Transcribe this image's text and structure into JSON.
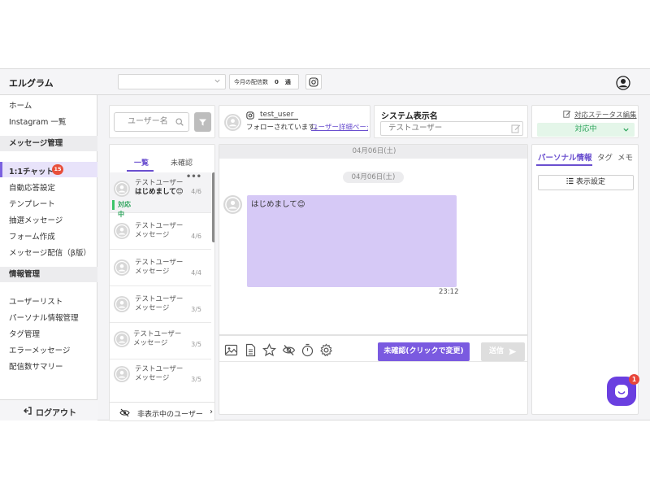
{
  "header": {
    "logo": "エルグラム",
    "account_select_value": "",
    "delivery_label": "今月の配信数",
    "delivery_count": "0",
    "delivery_unit": "通"
  },
  "sidebar": {
    "home": "ホーム",
    "instagram_list": "Instagram 一覧",
    "section_message": "メッセージ管理",
    "chat_1on1": "1:1チャット",
    "chat_badge": "15",
    "auto_reply": "自動応答設定",
    "template": "テンプレート",
    "lottery": "抽選メッセージ",
    "form": "フォーム作成",
    "broadcast": "メッセージ配信（β版）",
    "section_info": "情報管理",
    "user_list": "ユーザーリスト",
    "personal_info": "パーソナル情報管理",
    "tag_manage": "タグ管理",
    "error_message": "エラーメッセージ",
    "delivery_summary": "配信数サマリー",
    "logout": "ログアウト"
  },
  "userlist": {
    "search_placeholder": "ユーザー名",
    "tab_all": "一覧",
    "tab_unconfirmed": "未確認",
    "hidden_users": "非表示中のユーザー",
    "conversations": [
      {
        "name": "テストユーザー",
        "message": "はじめまして😊",
        "date": "4/6",
        "status": "対応中"
      },
      {
        "name": "テストユーザー",
        "message": "メッセージ",
        "date": "4/6"
      },
      {
        "name": "テストユーザー",
        "message": "メッセージ",
        "date": "4/4"
      },
      {
        "name": "テストユーザー",
        "message": "メッセージ",
        "date": "3/5"
      },
      {
        "name": "テストユーザー",
        "message": "メッセージ",
        "date": "3/5"
      },
      {
        "name": "テストユーザー",
        "message": "メッセージ",
        "date": "3/5"
      }
    ]
  },
  "profile": {
    "username": "test_user",
    "follow_status": "フォローされています。",
    "detail_link": "ユーザー詳細ページ"
  },
  "sysname": {
    "title": "システム表示名",
    "value": "テストユーザー"
  },
  "chat": {
    "date_top": "04月06日(土)",
    "date_pill": "04月06日(土)",
    "message_text": "はじめまして😊",
    "message_time": "23:12",
    "unconfirmed_button": "未確認(クリックで変更)",
    "send_button": "送信"
  },
  "status": {
    "edit_link": "対応ステータス編集",
    "current": "対応中"
  },
  "info_panel": {
    "tab_personal": "パーソナル情報",
    "tab_tag": "タグ",
    "tab_memo": "メモ",
    "display_settings": "表示設定"
  },
  "launcher": {
    "badge": "1"
  },
  "colors": {
    "accent": "#7a5ae0",
    "badge_red": "#e84f3a",
    "status_green": "#2ba35a"
  }
}
